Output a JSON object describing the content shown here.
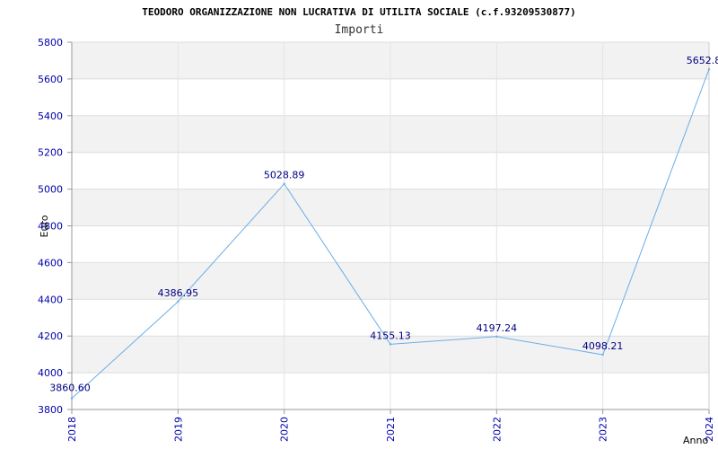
{
  "chart_data": {
    "type": "line",
    "title": "TEODORO ORGANIZZAZIONE NON LUCRATIVA DI UTILITA SOCIALE (c.f.93209530877)",
    "subtitle": "Importi",
    "xlabel": "Anno",
    "ylabel": "Euro",
    "x": [
      "2018",
      "2019",
      "2020",
      "2021",
      "2022",
      "2023",
      "2024"
    ],
    "series": [
      {
        "values": [
          3860.6,
          4386.95,
          5028.89,
          4155.13,
          4197.24,
          4098.21,
          5652.8
        ],
        "labels": [
          "3860.60",
          "4386.95",
          "5028.89",
          "4155.13",
          "4197.24",
          "4098.21",
          "5652.8"
        ]
      }
    ],
    "yticks": [
      "3800",
      "4000",
      "4200",
      "4400",
      "4600",
      "4800",
      "5000",
      "5200",
      "5400",
      "5600",
      "5800"
    ],
    "ylim": [
      3800,
      5800
    ],
    "grid": true,
    "colors": {
      "line": "#6aaee8",
      "band": "#f2f2f2",
      "tick_text": "#0000aa",
      "label_text": "#000080"
    }
  }
}
